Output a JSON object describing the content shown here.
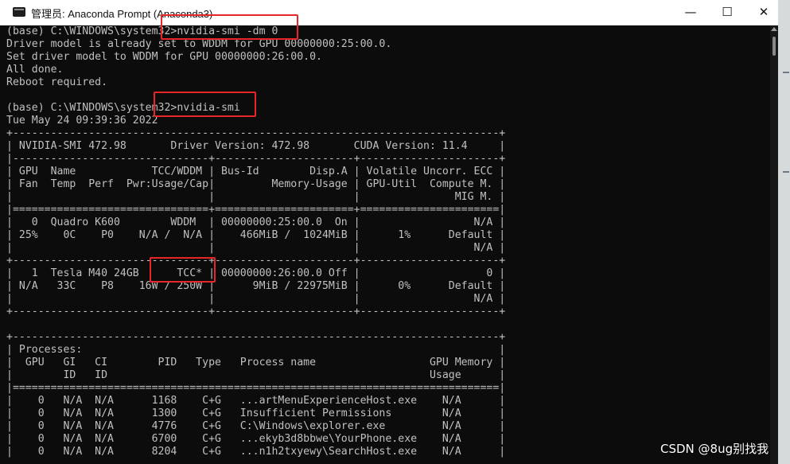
{
  "window": {
    "title": "管理员: Anaconda Prompt (Anaconda3)",
    "minimize_glyph": "—",
    "maximize_glyph": "☐",
    "close_glyph": "✕"
  },
  "terminal": {
    "lines": [
      "(base) C:\\WINDOWS\\system32>nvidia-smi -dm 0",
      "Driver model is already set to WDDM for GPU 00000000:25:00.0.",
      "Set driver model to WDDM for GPU 00000000:26:00.0.",
      "All done.",
      "Reboot required.",
      "",
      "(base) C:\\WINDOWS\\system32>nvidia-smi",
      "Tue May 24 09:39:36 2022",
      "+-----------------------------------------------------------------------------+",
      "| NVIDIA-SMI 472.98       Driver Version: 472.98       CUDA Version: 11.4     |",
      "|-------------------------------+----------------------+----------------------+",
      "| GPU  Name            TCC/WDDM | Bus-Id        Disp.A | Volatile Uncorr. ECC |",
      "| Fan  Temp  Perf  Pwr:Usage/Cap|         Memory-Usage | GPU-Util  Compute M. |",
      "|                               |                      |               MIG M. |",
      "|===============================+======================+======================|",
      "|   0  Quadro K600        WDDM  | 00000000:25:00.0  On |                  N/A |",
      "| 25%    0C    P0    N/A /  N/A |    466MiB /  1024MiB |      1%      Default |",
      "|                               |                      |                  N/A |",
      "+-------------------------------+----------------------+----------------------+",
      "|   1  Tesla M40 24GB      TCC* | 00000000:26:00.0 Off |                    0 |",
      "| N/A   33C    P8    16W / 250W |      9MiB / 22975MiB |      0%      Default |",
      "|                               |                      |                  N/A |",
      "+-------------------------------+----------------------+----------------------+",
      "",
      "+-----------------------------------------------------------------------------+",
      "| Processes:                                                                  |",
      "|  GPU   GI   CI        PID   Type   Process name                  GPU Memory |",
      "|        ID   ID                                                   Usage      |",
      "|=============================================================================|",
      "|    0   N/A  N/A      1168    C+G   ...artMenuExperienceHost.exe    N/A      |",
      "|    0   N/A  N/A      1300    C+G   Insufficient Permissions        N/A      |",
      "|    0   N/A  N/A      4776    C+G   C:\\Windows\\explorer.exe         N/A      |",
      "|    0   N/A  N/A      6700    C+G   ...ekyb3d8bbwe\\YourPhone.exe    N/A      |",
      "|    0   N/A  N/A      8204    C+G   ...n1h2txyewy\\SearchHost.exe    N/A      |"
    ]
  },
  "watermark": "CSDN @8ug别找我",
  "colors": {
    "terminal_bg": "#0c0c0c",
    "terminal_fg": "#c0c0c0",
    "highlight": "#e8262a"
  }
}
